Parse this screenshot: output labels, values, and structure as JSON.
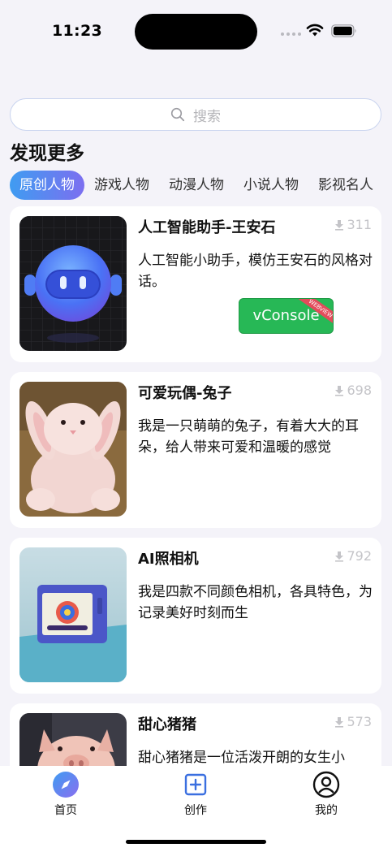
{
  "status_bar": {
    "time": "11:23"
  },
  "search": {
    "placeholder": "搜索"
  },
  "section_title": "发现更多",
  "tabs": [
    {
      "label": "原创人物",
      "active": true
    },
    {
      "label": "游戏人物",
      "active": false
    },
    {
      "label": "动漫人物",
      "active": false
    },
    {
      "label": "小说人物",
      "active": false
    },
    {
      "label": "影视名人",
      "active": false
    }
  ],
  "cards": [
    {
      "title": "人工智能助手-王安石",
      "count": "311",
      "description": "人工智能小助手，模仿王安石的风格对话。",
      "thumb": "robot-avatar-image"
    },
    {
      "title": "可爱玩偶-兔子",
      "count": "698",
      "description": "我是一只萌萌的兔子，有着大大的耳朵，给人带来可爱和温暖的感觉",
      "thumb": "plush-rabbit-image"
    },
    {
      "title": "AI照相机",
      "count": "792",
      "description": "我是四款不同颜色相机，各具特色，为记录美好时刻而生",
      "thumb": "camera-device-image"
    },
    {
      "title": "甜心猪猪",
      "count": "573",
      "description": "甜心猪猪是一位活泼开朗的女生小",
      "thumb": "plush-pig-image"
    }
  ],
  "vconsole": {
    "label": "vConsole",
    "ribbon": "WEBVIEW"
  },
  "tab_bar": [
    {
      "label": "首页",
      "icon": "compass-icon",
      "active": true
    },
    {
      "label": "创作",
      "icon": "plus-square-icon",
      "active": false
    },
    {
      "label": "我的",
      "icon": "user-icon",
      "active": false
    }
  ],
  "colors": {
    "accent_gradient_start": "#3f9cf1",
    "accent_gradient_end": "#7c6ff0",
    "vconsole_green": "#27b856",
    "background": "#f4f3f9"
  }
}
